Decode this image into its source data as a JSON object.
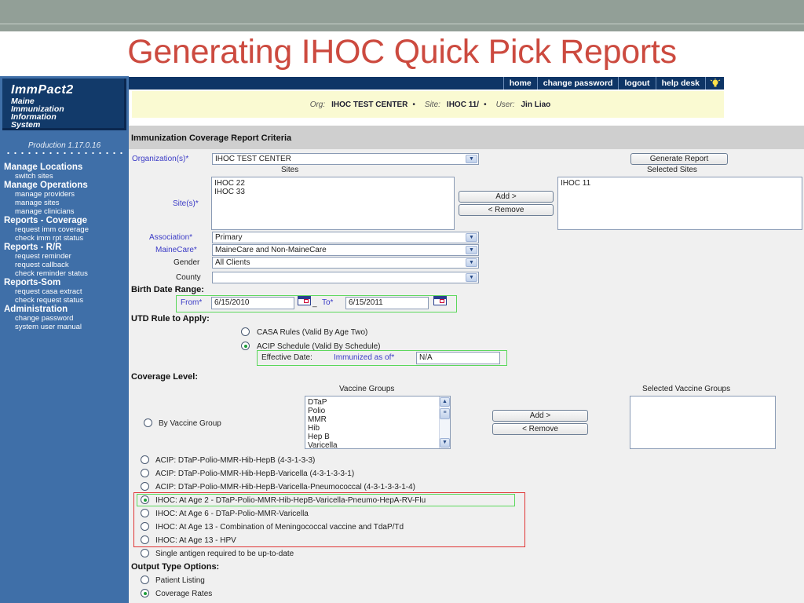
{
  "slide": {
    "title": "Generating IHOC Quick Pick Reports"
  },
  "app": {
    "logo": {
      "name": "ImmPact2",
      "subtitle": [
        "Maine",
        "Immunization",
        "Information",
        "System"
      ]
    },
    "version": "Production 1.17.0.16",
    "sidebar": [
      {
        "group": "Manage Locations",
        "items": [
          "switch sites"
        ]
      },
      {
        "group": "Manage Operations",
        "items": [
          "manage providers",
          "manage sites",
          "manage clinicians"
        ]
      },
      {
        "group": "Reports - Coverage",
        "items": [
          "request imm coverage",
          "check imm rpt status"
        ]
      },
      {
        "group": "Reports - R/R",
        "items": [
          "request reminder",
          "request callback",
          "check reminder status"
        ]
      },
      {
        "group": "Reports-Som",
        "items": [
          "request casa extract",
          "check request status"
        ]
      },
      {
        "group": "Administration",
        "items": [
          "change password",
          "system user manual"
        ]
      }
    ],
    "topnav": {
      "links": [
        "home",
        "change password",
        "logout",
        "help desk"
      ],
      "help_icon": "lightbulb-icon"
    },
    "context": {
      "org_label": "Org:",
      "org": "IHOC TEST CENTER",
      "site_label": "Site:",
      "site": "IHOC 11/",
      "user_label": "User:",
      "user": "Jin Liao",
      "separator": "•"
    }
  },
  "form": {
    "header": "Immunization Coverage Report Criteria",
    "generate_button": "Generate Report",
    "organization": {
      "label": "Organization(s)*",
      "value": "IHOC TEST CENTER"
    },
    "sites": {
      "label": "Site(s)*",
      "available_title": "Sites",
      "available": [
        "IHOC 22",
        "IHOC 33"
      ],
      "selected_title": "Selected Sites",
      "selected": [
        "IHOC 11"
      ],
      "add_button": "Add >",
      "remove_button": "< Remove"
    },
    "association": {
      "label": "Association*",
      "value": "Primary"
    },
    "mainecare": {
      "label": "MaineCare*",
      "value": "MaineCare and Non-MaineCare"
    },
    "gender": {
      "label": "Gender",
      "value": "All Clients"
    },
    "county": {
      "label": "County",
      "value": ""
    },
    "birth_date_range": {
      "title": "Birth Date Range:",
      "from_label": "From*",
      "from_value": "6/15/2010",
      "separator": "_",
      "to_label": "To*",
      "to_value": "6/15/2011"
    },
    "utd_rule": {
      "title": "UTD Rule to Apply:",
      "options": [
        {
          "label": "CASA Rules (Valid By Age Two)",
          "selected": false
        },
        {
          "label": "ACIP Schedule (Valid By Schedule)",
          "selected": true
        }
      ],
      "effective_date_label": "Effective Date:",
      "immunized_label": "Immunized as of*",
      "immunized_value": "N/A"
    },
    "coverage_level": {
      "title": "Coverage Level:",
      "by_vaccine_group": {
        "label": "By Vaccine Group",
        "selected": false
      },
      "vaccine_groups_title": "Vaccine Groups",
      "vaccine_groups": [
        "DTaP",
        "Polio",
        "MMR",
        "Hib",
        "Hep B",
        "Varicella"
      ],
      "selected_groups_title": "Selected Vaccine Groups",
      "selected_groups": [],
      "add_button": "Add >",
      "remove_button": "< Remove",
      "options": [
        {
          "label": "ACIP: DTaP-Polio-MMR-Hib-HepB (4-3-1-3-3)",
          "selected": false
        },
        {
          "label": "ACIP: DTaP-Polio-MMR-Hib-HepB-Varicella (4-3-1-3-3-1)",
          "selected": false
        },
        {
          "label": "ACIP: DTaP-Polio-MMR-Hib-HepB-Varicella-Pneumococcal (4-3-1-3-3-1-4)",
          "selected": false
        },
        {
          "label": "IHOC: At Age 2 - DTaP-Polio-MMR-Hib-HepB-Varicella-Pneumo-HepA-RV-Flu",
          "selected": true
        },
        {
          "label": "IHOC: At Age 6 - DTaP-Polio-MMR-Varicella",
          "selected": false
        },
        {
          "label": "IHOC: At Age 13 - Combination of Meningococcal vaccine and TdaP/Td",
          "selected": false
        },
        {
          "label": "IHOC: At Age 13 - HPV",
          "selected": false
        },
        {
          "label": "Single antigen required to be up-to-date",
          "selected": false
        }
      ]
    },
    "output_type": {
      "title": "Output Type Options:",
      "options": [
        {
          "label": "Patient Listing",
          "selected": false
        },
        {
          "label": "Coverage Rates",
          "selected": true
        }
      ]
    }
  }
}
